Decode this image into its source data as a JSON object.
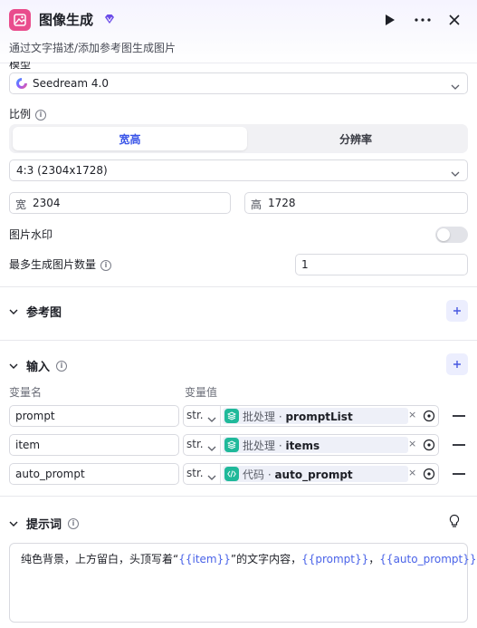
{
  "header": {
    "title": "图像生成",
    "subtitle": "通过文字描述/添加参考图生成图片",
    "brand_color": "#e94d8d",
    "badge_color": "#6b4be8",
    "icons": [
      "run-icon",
      "more-icon",
      "close-icon"
    ]
  },
  "model": {
    "partial_label": "模型",
    "selected": "Seedream 4.0"
  },
  "ratio": {
    "label": "比例",
    "tabs": [
      "宽高",
      "分辨率"
    ],
    "active_tab": "宽高",
    "selected": "4:3 (2304x1728)",
    "width_prefix": "宽",
    "width_value": "2304",
    "height_prefix": "高",
    "height_value": "1728"
  },
  "watermark": {
    "label": "图片水印",
    "enabled": false
  },
  "max_images": {
    "label": "最多生成图片数量",
    "value": "1"
  },
  "reference": {
    "title": "参考图"
  },
  "inputs": {
    "title": "输入",
    "col_name": "变量名",
    "col_value": "变量值",
    "rows": [
      {
        "name": "prompt",
        "type": "str.",
        "source": "批处理 · ",
        "variable": "promptList",
        "source_icon": "layers-icon"
      },
      {
        "name": "item",
        "type": "str.",
        "source": "批处理 · ",
        "variable": "items",
        "source_icon": "layers-icon"
      },
      {
        "name": "auto_prompt",
        "type": "str.",
        "source": "代码 · ",
        "variable": "auto_prompt",
        "source_icon": "code-icon"
      }
    ]
  },
  "prompt_section": {
    "title": "提示词",
    "text_1": "纯色背景，上方留白，头顶写着“",
    "var_1": "{{item}}",
    "text_2": "”的文字内容，",
    "var_2": "{{prompt}}",
    "text_3": "，",
    "var_3": "{{auto_prompt}}"
  }
}
